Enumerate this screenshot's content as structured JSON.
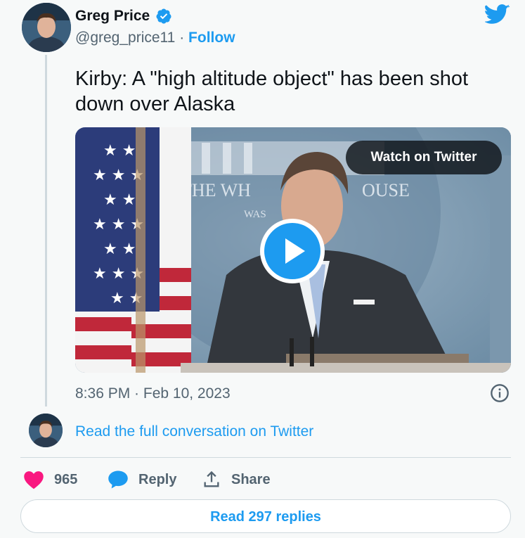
{
  "author": {
    "name": "Greg Price",
    "handle": "@greg_price11",
    "separator": "·",
    "follow_label": "Follow"
  },
  "tweet": {
    "text": "Kirby: A \"high altitude object\" has been shot down over Alaska",
    "timestamp": "8:36 PM · Feb 10, 2023"
  },
  "media": {
    "watch_label": "Watch on Twitter",
    "backdrop_text": [
      "THE WH",
      "OUSE",
      "WAS"
    ]
  },
  "conversation": {
    "read_full_label": "Read the full conversation on Twitter"
  },
  "actions": {
    "like_count": "965",
    "reply_label": "Reply",
    "share_label": "Share"
  },
  "footer": {
    "read_replies_label": "Read 297 replies"
  },
  "colors": {
    "accent": "#1d9bf0",
    "like": "#f91880",
    "muted": "#536471",
    "text": "#0f1419"
  },
  "icons": [
    "verified-badge-icon",
    "twitter-bird-icon",
    "play-icon",
    "info-icon",
    "heart-icon",
    "reply-bubble-icon",
    "share-icon"
  ]
}
